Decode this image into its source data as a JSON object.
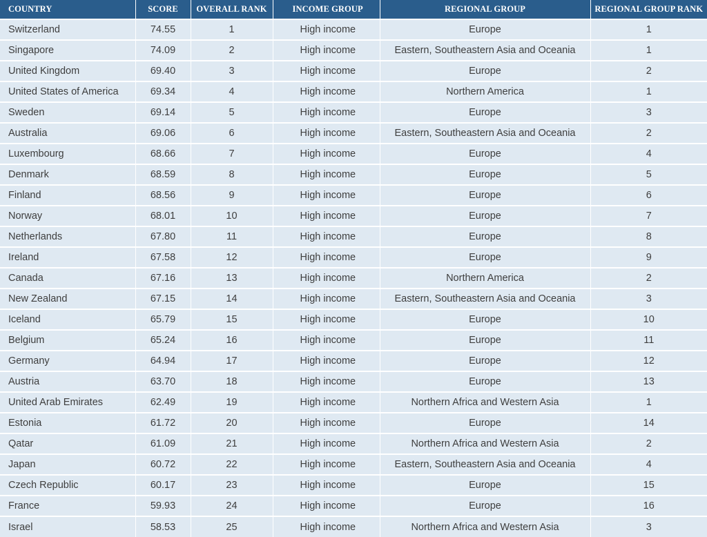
{
  "headers": {
    "country": "COUNTRY",
    "score": "SCORE",
    "overall_rank": "OVERALL RANK",
    "income_group": "INCOME GROUP",
    "regional_group": "REGIONAL GROUP",
    "regional_group_rank": "REGIONAL GROUP RANK"
  },
  "rows": [
    {
      "country": "Switzerland",
      "score": "74.55",
      "overall_rank": "1",
      "income_group": "High income",
      "regional_group": "Europe",
      "regional_group_rank": "1"
    },
    {
      "country": "Singapore",
      "score": "74.09",
      "overall_rank": "2",
      "income_group": "High income",
      "regional_group": "Eastern, Southeastern Asia and Oceania",
      "regional_group_rank": "1"
    },
    {
      "country": "United Kingdom",
      "score": "69.40",
      "overall_rank": "3",
      "income_group": "High income",
      "regional_group": "Europe",
      "regional_group_rank": "2"
    },
    {
      "country": "United States of America",
      "score": "69.34",
      "overall_rank": "4",
      "income_group": "High income",
      "regional_group": "Northern America",
      "regional_group_rank": "1"
    },
    {
      "country": "Sweden",
      "score": "69.14",
      "overall_rank": "5",
      "income_group": "High income",
      "regional_group": "Europe",
      "regional_group_rank": "3"
    },
    {
      "country": "Australia",
      "score": "69.06",
      "overall_rank": "6",
      "income_group": "High income",
      "regional_group": "Eastern, Southeastern Asia and Oceania",
      "regional_group_rank": "2"
    },
    {
      "country": "Luxembourg",
      "score": "68.66",
      "overall_rank": "7",
      "income_group": "High income",
      "regional_group": "Europe",
      "regional_group_rank": "4"
    },
    {
      "country": "Denmark",
      "score": "68.59",
      "overall_rank": "8",
      "income_group": "High income",
      "regional_group": "Europe",
      "regional_group_rank": "5"
    },
    {
      "country": "Finland",
      "score": "68.56",
      "overall_rank": "9",
      "income_group": "High income",
      "regional_group": "Europe",
      "regional_group_rank": "6"
    },
    {
      "country": "Norway",
      "score": "68.01",
      "overall_rank": "10",
      "income_group": "High income",
      "regional_group": "Europe",
      "regional_group_rank": "7"
    },
    {
      "country": "Netherlands",
      "score": "67.80",
      "overall_rank": "11",
      "income_group": "High income",
      "regional_group": "Europe",
      "regional_group_rank": "8"
    },
    {
      "country": "Ireland",
      "score": "67.58",
      "overall_rank": "12",
      "income_group": "High income",
      "regional_group": "Europe",
      "regional_group_rank": "9"
    },
    {
      "country": "Canada",
      "score": "67.16",
      "overall_rank": "13",
      "income_group": "High income",
      "regional_group": "Northern America",
      "regional_group_rank": "2"
    },
    {
      "country": "New Zealand",
      "score": "67.15",
      "overall_rank": "14",
      "income_group": "High income",
      "regional_group": "Eastern, Southeastern Asia and Oceania",
      "regional_group_rank": "3"
    },
    {
      "country": "Iceland",
      "score": "65.79",
      "overall_rank": "15",
      "income_group": "High income",
      "regional_group": "Europe",
      "regional_group_rank": "10"
    },
    {
      "country": "Belgium",
      "score": "65.24",
      "overall_rank": "16",
      "income_group": "High income",
      "regional_group": "Europe",
      "regional_group_rank": "11"
    },
    {
      "country": "Germany",
      "score": "64.94",
      "overall_rank": "17",
      "income_group": "High income",
      "regional_group": "Europe",
      "regional_group_rank": "12"
    },
    {
      "country": "Austria",
      "score": "63.70",
      "overall_rank": "18",
      "income_group": "High income",
      "regional_group": "Europe",
      "regional_group_rank": "13"
    },
    {
      "country": "United Arab Emirates",
      "score": "62.49",
      "overall_rank": "19",
      "income_group": "High income",
      "regional_group": "Northern Africa and Western Asia",
      "regional_group_rank": "1"
    },
    {
      "country": "Estonia",
      "score": "61.72",
      "overall_rank": "20",
      "income_group": "High income",
      "regional_group": "Europe",
      "regional_group_rank": "14"
    },
    {
      "country": "Qatar",
      "score": "61.09",
      "overall_rank": "21",
      "income_group": "High income",
      "regional_group": "Northern Africa and Western Asia",
      "regional_group_rank": "2"
    },
    {
      "country": "Japan",
      "score": "60.72",
      "overall_rank": "22",
      "income_group": "High income",
      "regional_group": "Eastern, Southeastern Asia and Oceania",
      "regional_group_rank": "4"
    },
    {
      "country": "Czech Republic",
      "score": "60.17",
      "overall_rank": "23",
      "income_group": "High income",
      "regional_group": "Europe",
      "regional_group_rank": "15"
    },
    {
      "country": "France",
      "score": "59.93",
      "overall_rank": "24",
      "income_group": "High income",
      "regional_group": "Europe",
      "regional_group_rank": "16"
    },
    {
      "country": "Israel",
      "score": "58.53",
      "overall_rank": "25",
      "income_group": "High income",
      "regional_group": "Northern Africa and Western Asia",
      "regional_group_rank": "3"
    }
  ],
  "colors": {
    "header_bg": "#2a5d8c",
    "header_text": "#ffffff",
    "row_bg": "#dfe9f2",
    "row_text": "#3e3e3e"
  }
}
